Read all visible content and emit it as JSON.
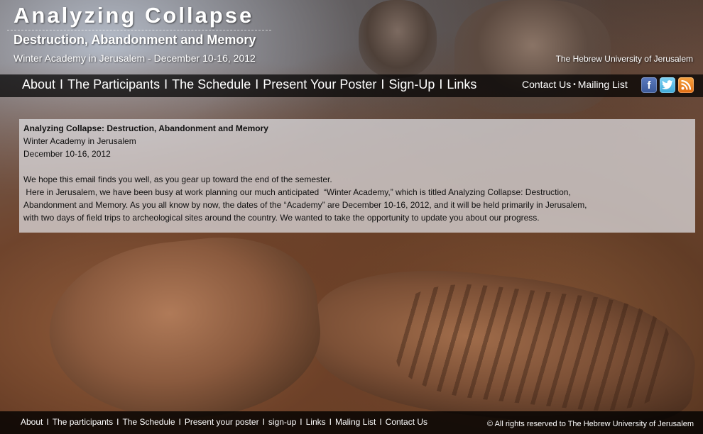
{
  "header": {
    "title": "Analyzing Collapse",
    "subtitle": "Destruction, Abandonment and Memory",
    "tagline": "Winter Academy in Jerusalem - December 10-16, 2012",
    "university": "The Hebrew University of Jerusalem"
  },
  "nav": {
    "separator": "I",
    "items": [
      {
        "label": "About"
      },
      {
        "label": "The Participants"
      },
      {
        "label": "The Schedule"
      },
      {
        "label": "Present Your Poster"
      },
      {
        "label": "Sign-Up"
      },
      {
        "label": "Links"
      }
    ]
  },
  "utility": {
    "contact": "Contact Us",
    "dot": "•",
    "mailing": "Mailing List",
    "icons": [
      {
        "name": "facebook-icon",
        "glyph": "f"
      },
      {
        "name": "twitter-icon",
        "glyph": "t"
      },
      {
        "name": "rss-icon",
        "glyph": ")"
      }
    ]
  },
  "content": {
    "heading": "Analyzing Collapse: Destruction, Abandonment and Memory",
    "line2": "Winter Academy in Jerusalem",
    "line3": "December 10-16, 2012",
    "para1": "We hope this email finds you well, as you gear up toward the end of the semester.",
    "para2a": " Here in Jerusalem, we have been busy at work planning our much anticipated  “Winter Academy,” which is titled Analyzing Collapse: Destruction,",
    "para2b": "Abandonment and Memory. As you all know by now, the dates of the “Academy” are December 10-16, 2012, and it will be held primarily in Jerusalem,",
    "para2c": "with two days of field trips to archeological sites around the country. We wanted to take the opportunity to update you about our progress."
  },
  "footer": {
    "separator": "I",
    "items": [
      {
        "label": "About"
      },
      {
        "label": "The participants"
      },
      {
        "label": "The Schedule"
      },
      {
        "label": "Present your poster"
      },
      {
        "label": "sign-up"
      },
      {
        "label": "Links"
      },
      {
        "label": "Maling List"
      },
      {
        "label": "Contact Us"
      }
    ],
    "copyright": "© All rights reserved to The Hebrew University of Jerusalem"
  }
}
